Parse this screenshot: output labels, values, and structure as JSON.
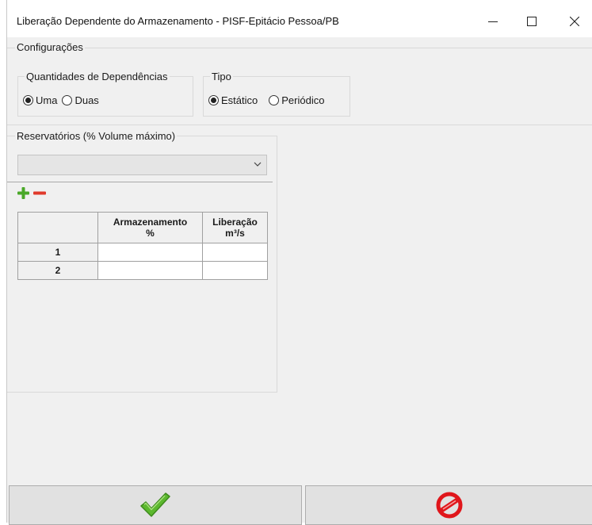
{
  "window": {
    "title": "Liberação Dependente do Armazenamento - PISF-Epitácio Pessoa/PB",
    "controls": {
      "minimize": "minimize-icon",
      "maximize": "maximize-icon",
      "close": "close-icon"
    }
  },
  "config": {
    "group_label": "Configurações",
    "dependencias": {
      "label": "Quantidades de Dependências",
      "options": [
        {
          "label": "Uma",
          "checked": true
        },
        {
          "label": "Duas",
          "checked": false
        }
      ]
    },
    "tipo": {
      "label": "Tipo",
      "options": [
        {
          "label": "Estático",
          "checked": true
        },
        {
          "label": "Periódico",
          "checked": false
        }
      ]
    }
  },
  "reservatorios": {
    "label": "Reservatórios (% Volume máximo)",
    "combo_value": "",
    "add_icon": "plus-icon",
    "remove_icon": "minus-icon",
    "table": {
      "headers": [
        {
          "line1": "",
          "line2": ""
        },
        {
          "line1": "Armazenamento",
          "line2": "%"
        },
        {
          "line1": "Liberação",
          "line2": "m³/s"
        }
      ],
      "rows": [
        {
          "label": "1",
          "armazenamento": "",
          "liberacao": ""
        },
        {
          "label": "2",
          "armazenamento": "",
          "liberacao": ""
        }
      ]
    }
  },
  "buttons": {
    "ok_icon": "checkmark-icon",
    "cancel_icon": "cancel-icon",
    "colors": {
      "check": "#5cb82e",
      "cancel": "#e0161b",
      "plus": "#4aa828",
      "minus": "#e03a2c"
    }
  }
}
